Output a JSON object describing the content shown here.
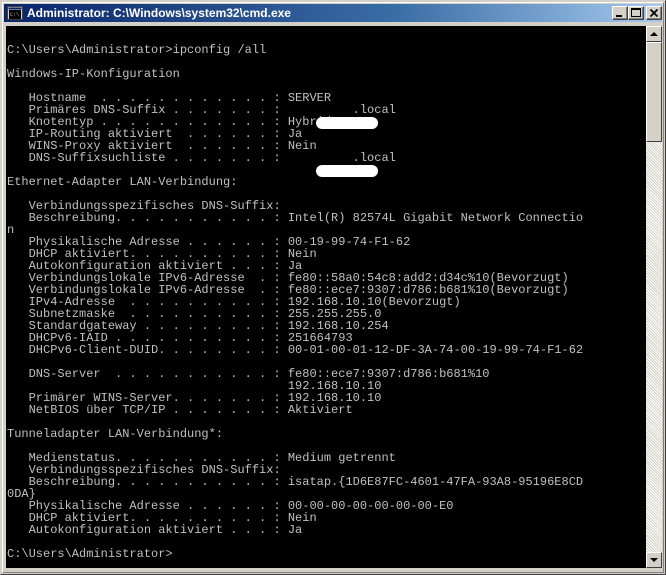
{
  "window": {
    "title": "Administrator: C:\\Windows\\system32\\cmd.exe",
    "icon": "cmd-icon",
    "buttons": [
      "minimize-icon",
      "maximize-icon",
      "close-icon"
    ]
  },
  "console": {
    "foreground": "#c0c0c0",
    "background": "#000000",
    "lines": [
      "",
      "C:\\Users\\Administrator>ipconfig /all",
      "",
      "Windows-IP-Konfiguration",
      "",
      "   Hostname  . . . . . . . . . . . . : SERVER",
      "   Primäres DNS-Suffix . . . . . . . :          .local",
      "   Knotentyp . . . . . . . . . . . . : Hybrid",
      "   IP-Routing aktiviert  . . . . . . : Ja",
      "   WINS-Proxy aktiviert  . . . . . . : Nein",
      "   DNS-Suffixsuchliste . . . . . . . :          .local",
      "",
      "Ethernet-Adapter LAN-Verbindung:",
      "",
      "   Verbindungsspezifisches DNS-Suffix:",
      "   Beschreibung. . . . . . . . . . . : Intel(R) 82574L Gigabit Network Connectio",
      "n",
      "   Physikalische Adresse . . . . . . : 00-19-99-74-F1-62",
      "   DHCP aktiviert. . . . . . . . . . : Nein",
      "   Autokonfiguration aktiviert . . . : Ja",
      "   Verbindungslokale IPv6-Adresse  . : fe80::58a0:54c8:add2:d34c%10(Bevorzugt)",
      "   Verbindungslokale IPv6-Adresse  . : fe80::ece7:9307:d786:b681%10(Bevorzugt)",
      "   IPv4-Adresse  . . . . . . . . . . : 192.168.10.10(Bevorzugt)",
      "   Subnetzmaske  . . . . . . . . . . : 255.255.255.0",
      "   Standardgateway . . . . . . . . . : 192.168.10.254",
      "   DHCPv6-IAID . . . . . . . . . . . : 251664793",
      "   DHCPv6-Client-DUID. . . . . . . . : 00-01-00-01-12-DF-3A-74-00-19-99-74-F1-62",
      "",
      "   DNS-Server  . . . . . . . . . . . : fe80::ece7:9307:d786:b681%10",
      "                                       192.168.10.10",
      "   Primärer WINS-Server. . . . . . . : 192.168.10.10",
      "   NetBIOS über TCP/IP . . . . . . . : Aktiviert",
      "",
      "Tunneladapter LAN-Verbindung*:",
      "",
      "   Medienstatus. . . . . . . . . . . : Medium getrennt",
      "   Verbindungsspezifisches DNS-Suffix:",
      "   Beschreibung. . . . . . . . . . . : isatap.{1D6E87FC-4601-47FA-93A8-95196E8CD",
      "0DA}",
      "   Physikalische Adresse . . . . . . : 00-00-00-00-00-00-00-E0",
      "   DHCP aktiviert. . . . . . . . . . : Nein",
      "   Autokonfiguration aktiviert . . . : Ja",
      "",
      "C:\\Users\\Administrator>"
    ]
  }
}
